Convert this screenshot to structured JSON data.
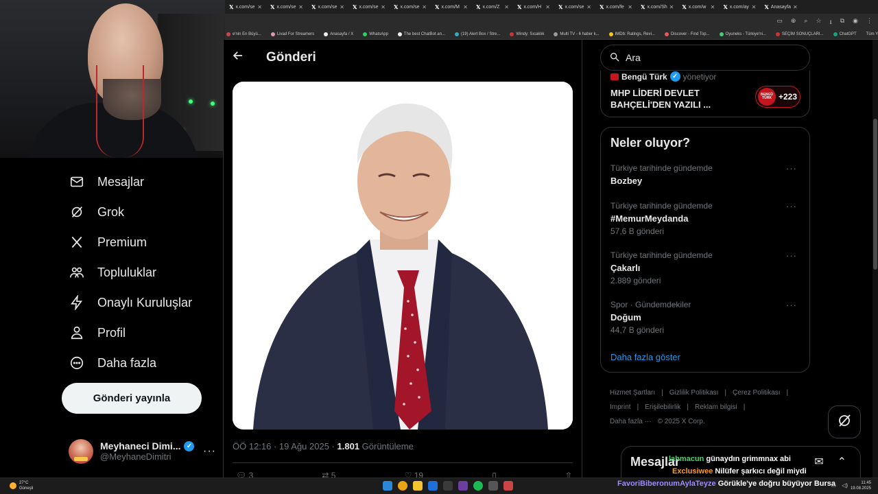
{
  "browser": {
    "tabs": [
      "x.com/se",
      "x.com/se",
      "x.com/se",
      "x.com/se",
      "x.com/se",
      "x.com/M",
      "x.com/Z",
      "x.com/H",
      "x.com/se",
      "x.com/fe",
      "x.com/Sh",
      "x.com/w",
      "x.com/ay",
      "Anasayfa"
    ],
    "bookmarks": [
      "e'nin En Büyü...",
      "Livad For Streamers",
      "Anasayfa / X",
      "WhatsApp",
      "The best ChatBot an...",
      "(19) Alert Box / Stre...",
      "Windy: Sıcaklık",
      "Multi TV - 6 haber k...",
      "IMDb: Ratings, Revi...",
      "Discover - Find Top...",
      "Oyuneks - Türkiye'ni...",
      "SEÇİM SONUÇLARI...",
      "ChatGPT"
    ],
    "all_bookmarks": "Tüm Yer İşaretleri"
  },
  "nav": {
    "items": [
      {
        "label": "Mesajlar",
        "icon": "envelope-icon"
      },
      {
        "label": "Grok",
        "icon": "grok-icon"
      },
      {
        "label": "Premium",
        "icon": "x-logo-icon"
      },
      {
        "label": "Topluluklar",
        "icon": "communities-icon"
      },
      {
        "label": "Onaylı Kuruluşlar",
        "icon": "lightning-icon"
      },
      {
        "label": "Profil",
        "icon": "person-icon"
      },
      {
        "label": "Daha fazla",
        "icon": "more-circle-icon"
      }
    ],
    "post_button": "Gönderi yayınla",
    "profile": {
      "name": "Meyhaneci Dimi...",
      "handle": "@MeyhaneDimitri"
    }
  },
  "main": {
    "title": "Gönderi",
    "meta": {
      "time": "ÖÖ 12:16 · 19 Ağu 2025 · ",
      "views": "1.801",
      "views_label": " Görüntüleme"
    },
    "actions": {
      "replies": "3",
      "reposts": "5",
      "likes": "19"
    }
  },
  "sidebar": {
    "search_placeholder": "Ara",
    "ad": {
      "brand": "Bengü Türk",
      "suffix": "yönetiyor",
      "headline": "MHP LİDERİ DEVLET BAHÇELİ'DEN YAZILI ...",
      "badge_logo": "BENGÜ TÜRK",
      "badge_count": "+223"
    },
    "trends_title": "Neler oluyor?",
    "trends": [
      {
        "context": "Türkiye tarihinde gündemde",
        "title": "Bozbey",
        "count": ""
      },
      {
        "context": "Türkiye tarihinde gündemde",
        "title": "#MemurMeydanda",
        "count": "57,6 B gönderi"
      },
      {
        "context": "Türkiye tarihinde gündemde",
        "title": "Çakarlı",
        "count": "2.889 gönderi"
      },
      {
        "context": "Spor · Gündemdekiler",
        "title": "Doğum",
        "count": "44,7 B gönderi"
      }
    ],
    "show_more": "Daha fazla göster",
    "footer": {
      "line1": [
        "Hizmet Şartları",
        "|",
        "Gizlilik Politikası",
        "|",
        "Çerez Politikası",
        "|"
      ],
      "line2": [
        "Imprint",
        "|",
        "Erişilebilirlik",
        "|",
        "Reklam bilgisi",
        "|"
      ],
      "line3": [
        "Daha fazla ···",
        "© 2025 X Corp."
      ]
    }
  },
  "messages": {
    "title": "Mesajlar"
  },
  "chat": [
    {
      "user": "lahmacun",
      "message": "günaydın grimmnax abi"
    },
    {
      "user": "Exclusiwee",
      "message": "Nilüfer şarkıcı değil miydi"
    },
    {
      "user": "FavoriBiberonumAylaTeyze",
      "message": "Görükle'ye doğru büyüyor Bursa"
    }
  ],
  "taskbar": {
    "temp": "27°C",
    "weather": "Güneşli",
    "time": "11:45",
    "date": "19.08.2025"
  }
}
